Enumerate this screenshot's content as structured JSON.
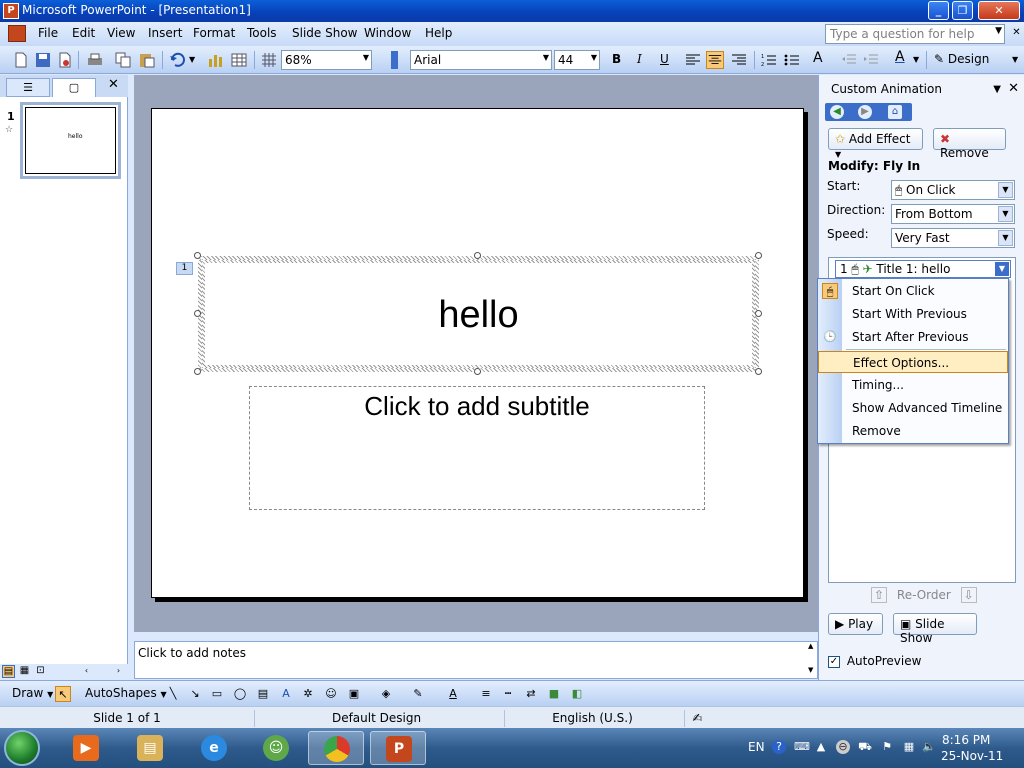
{
  "window": {
    "title": "Microsoft PowerPoint - [Presentation1]",
    "minimize": "_",
    "restore": "❐",
    "close": "✕"
  },
  "menubar": {
    "items": [
      "File",
      "Edit",
      "View",
      "Insert",
      "Format",
      "Tools",
      "Slide Show",
      "Window",
      "Help"
    ],
    "help_placeholder": "Type a question for help"
  },
  "toolbar": {
    "zoom": "68%",
    "font": "Arial",
    "font_size": "44",
    "bold": "B",
    "italic": "I",
    "underline": "U",
    "design_label": "Design"
  },
  "outline": {
    "slide_number": "1",
    "thumb_text": "hello"
  },
  "slide": {
    "title": "hello",
    "subtitle": "Click to add subtitle",
    "anim_tag": "1"
  },
  "notes": {
    "placeholder": "Click to add notes"
  },
  "taskpane": {
    "title": "Custom Animation",
    "add_effect": "Add Effect",
    "remove": "Remove",
    "modify": "Modify: Fly In",
    "start_label": "Start:",
    "start_value": "On Click",
    "direction_label": "Direction:",
    "direction_value": "From Bottom",
    "speed_label": "Speed:",
    "speed_value": "Very Fast",
    "list_item": {
      "index": "1",
      "label": "Title 1: hello"
    },
    "reorder": "Re-Order",
    "play": "Play",
    "slideshow": "Slide Show",
    "autopreview": "AutoPreview",
    "autopreview_checked": true
  },
  "context_menu": {
    "items": [
      "Start On Click",
      "Start With Previous",
      "Start After Previous",
      "Effect Options...",
      "Timing...",
      "Show Advanced Timeline",
      "Remove"
    ],
    "highlighted_index": 3
  },
  "drawbar": {
    "draw": "Draw",
    "autoshapes": "AutoShapes"
  },
  "statusbar": {
    "slide_info": "Slide 1 of 1",
    "design": "Default Design",
    "language": "English (U.S.)"
  },
  "taskbar": {
    "language": "EN",
    "time": "8:16 PM",
    "date": "25-Nov-11"
  },
  "colors": {
    "titlebar": "#0a5fd8",
    "highlight": "#ffeec2",
    "taskbar": "#2e5a8c"
  }
}
